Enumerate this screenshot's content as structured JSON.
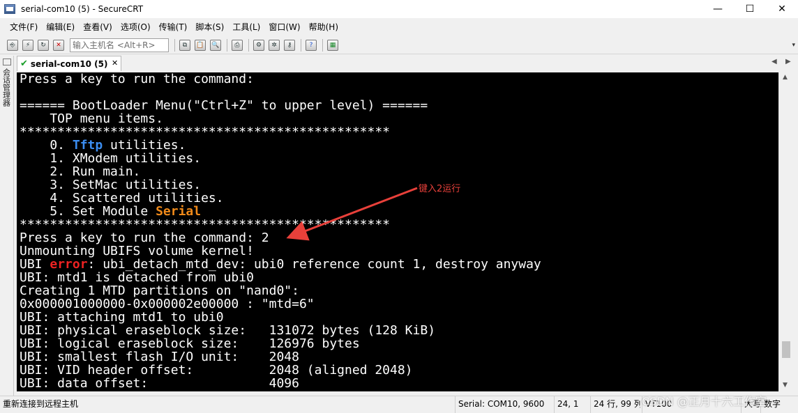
{
  "window": {
    "title": "serial-com10 (5) - SecureCRT",
    "minimize": "—",
    "maximize": "☐",
    "close": "✕"
  },
  "menu": [
    "文件(F)",
    "编辑(E)",
    "查看(V)",
    "选项(O)",
    "传输(T)",
    "脚本(S)",
    "工具(L)",
    "窗口(W)",
    "帮助(H)"
  ],
  "toolbar": {
    "host_placeholder": "输入主机名 <Alt+R>",
    "buttons_left": [
      "connect-icon",
      "quick-connect-icon",
      "reconnect-icon",
      "disconnect-icon"
    ],
    "buttons_right": [
      "copy-icon",
      "paste-icon",
      "find-icon",
      "print-icon",
      "session-options-icon",
      "global-options-icon",
      "keymap-icon",
      "help-icon",
      "sftp-icon"
    ]
  },
  "side_panel": {
    "label": "会话管理器"
  },
  "tab": {
    "label": "serial-com10 (5)",
    "close": "✕",
    "prev": "◀",
    "next": "▶"
  },
  "terminal": {
    "lines": [
      [
        {
          "t": "Press a key to run the command:"
        }
      ],
      [
        {
          "t": ""
        }
      ],
      [
        {
          "t": "====== BootLoader Menu(\"Ctrl+Z\" to upper level) ======"
        }
      ],
      [
        {
          "t": "    TOP menu items."
        }
      ],
      [
        {
          "t": "*************************************************"
        }
      ],
      [
        {
          "t": "    0. "
        },
        {
          "t": "Tftp",
          "c": "blue"
        },
        {
          "t": " utilities."
        }
      ],
      [
        {
          "t": "    1. XModem utilities."
        }
      ],
      [
        {
          "t": "    2. Run main."
        }
      ],
      [
        {
          "t": "    3. SetMac utilities."
        }
      ],
      [
        {
          "t": "    4. Scattered utilities."
        }
      ],
      [
        {
          "t": "    5. Set Module "
        },
        {
          "t": "Serial",
          "c": "orange"
        }
      ],
      [
        {
          "t": "*************************************************"
        }
      ],
      [
        {
          "t": "Press a key to run the command: 2"
        }
      ],
      [
        {
          "t": "Unmounting UBIFS volume kernel!"
        }
      ],
      [
        {
          "t": "UBI "
        },
        {
          "t": "error",
          "c": "red"
        },
        {
          "t": ": ubi_detach_mtd_dev: ubi0 reference count 1, destroy anyway"
        }
      ],
      [
        {
          "t": "UBI: mtd1 is detached from ubi0"
        }
      ],
      [
        {
          "t": "Creating 1 MTD partitions on \"nand0\":"
        }
      ],
      [
        {
          "t": "0x000001000000-0x000002e00000 : \"mtd=6\""
        }
      ],
      [
        {
          "t": "UBI: attaching mtd1 to ubi0"
        }
      ],
      [
        {
          "t": "UBI: physical eraseblock size:   131072 bytes (128 KiB)"
        }
      ],
      [
        {
          "t": "UBI: logical eraseblock size:    126976 bytes"
        }
      ],
      [
        {
          "t": "UBI: smallest flash I/O unit:    2048"
        }
      ],
      [
        {
          "t": "UBI: VID header offset:          2048 (aligned 2048)"
        }
      ],
      [
        {
          "t": "UBI: data offset:                4096"
        }
      ]
    ]
  },
  "annotation": {
    "text": "键入2运行",
    "color": "#e8403a"
  },
  "status": {
    "message": "重新连接到远程主机",
    "serial": "Serial: COM10, 9600",
    "cursor": "24,  1",
    "size": "24 行, 99 列",
    "term": "VT100",
    "mode1": "大写",
    "mode2": "数字"
  },
  "watermark": "CSDN @正月十六工作室",
  "colors": {
    "terminal_bg": "#000000",
    "blue": "#3b8df0",
    "orange": "#f08a1a",
    "red": "#ee2222",
    "tab_check": "#1a9e2a"
  }
}
